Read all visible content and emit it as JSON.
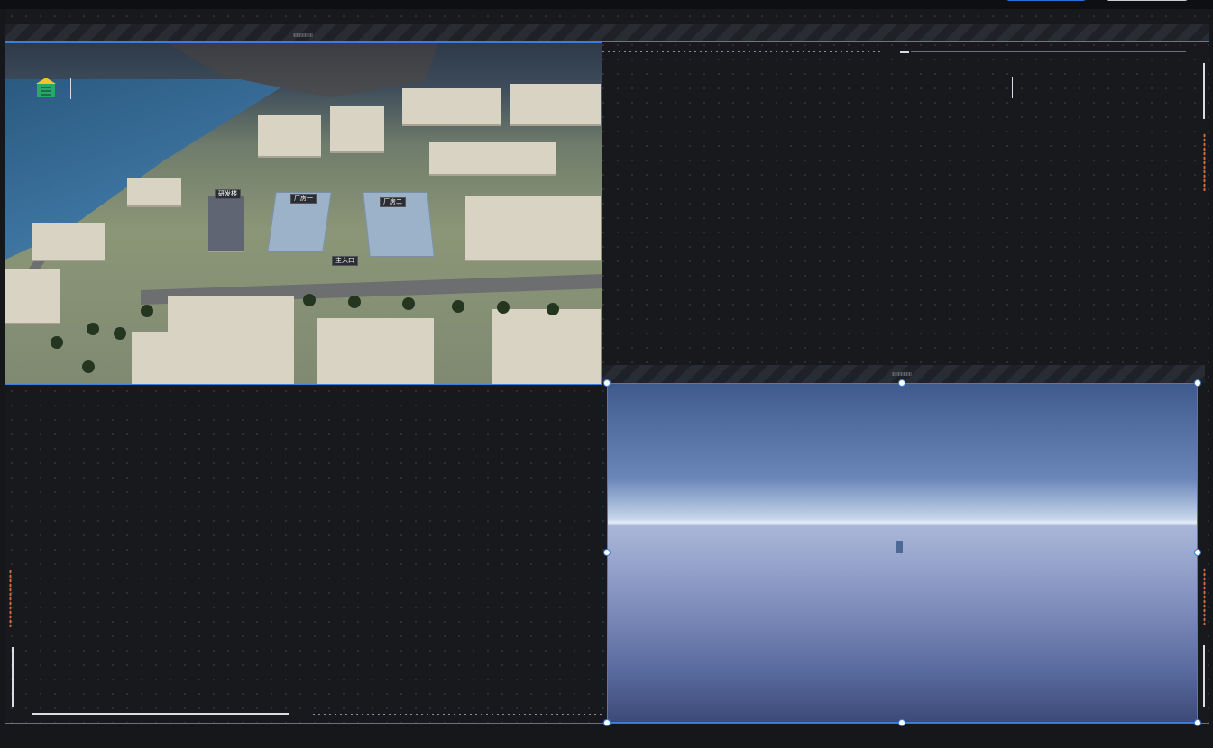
{
  "window": {
    "top_buttons": [
      "primary-action",
      "secondary-action"
    ]
  },
  "city_view": {
    "labels": [
      "研发楼",
      "厂房一",
      "厂房二",
      "主入口"
    ],
    "icon": "warehouse-home-icon"
  },
  "scene_view": {
    "icon": "none"
  },
  "colors": {
    "accent": "#3b7de0",
    "icon_green": "#2aa86b",
    "icon_yellow": "#f2c230"
  }
}
